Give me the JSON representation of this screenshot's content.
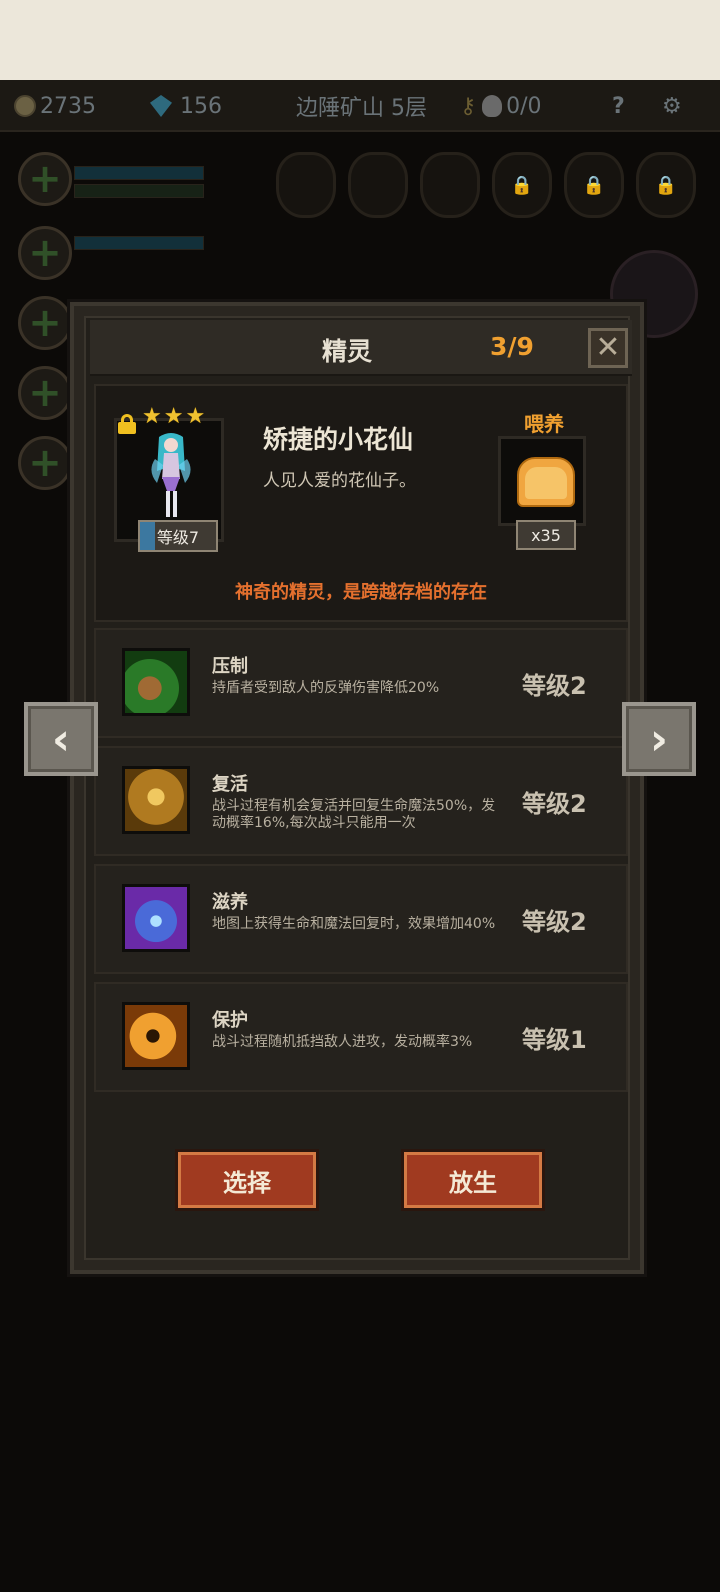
{
  "header": {
    "gold": "2735",
    "gems": "156",
    "location": "边陲矿山 5层",
    "keys": "0/0",
    "help": "?"
  },
  "dialog": {
    "title": "精灵",
    "count": "3/9",
    "close": "✕",
    "fairy": {
      "name": "矫捷的小花仙",
      "description": "人见人爱的花仙子。",
      "stars": 3,
      "level_label": "等级7",
      "level_progress": 0.2,
      "locked": true
    },
    "feed": {
      "label": "喂养",
      "count": "x35"
    },
    "notice": "神奇的精灵，是跨越存档的存在",
    "skills": [
      {
        "name": "压制",
        "description": "持盾者受到敌人的反弹伤害降低20%",
        "level": "等级2",
        "icon": "suppress-claw-icon"
      },
      {
        "name": "复活",
        "description": "战斗过程有机会复活并回复生命魔法50%，发动概率16%,每次战斗只能用一次",
        "level": "等级2",
        "icon": "revive-figure-icon"
      },
      {
        "name": "滋养",
        "description": "地图上获得生命和魔法回复时，效果增加40%",
        "level": "等级2",
        "icon": "nourish-fairy-icon"
      },
      {
        "name": "保护",
        "description": "战斗过程随机抵挡敌人进攻，发动概率3%",
        "level": "等级1",
        "icon": "protect-aura-icon"
      }
    ],
    "buttons": {
      "select": "选择",
      "release": "放生"
    },
    "nav": {
      "prev": "‹",
      "next": "›"
    }
  },
  "colors": {
    "accent_orange": "#f0a030",
    "notice_red": "#e4702e",
    "button_red": "#a03a20"
  }
}
